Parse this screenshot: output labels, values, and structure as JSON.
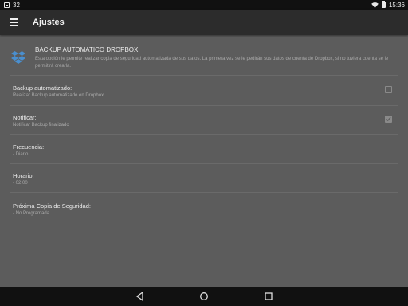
{
  "status_bar": {
    "notification_count": "32",
    "time": "15:36"
  },
  "app_bar": {
    "title": "Ajustes"
  },
  "header": {
    "title": "BACKUP AUTOMATICO DROPBOX",
    "description": "Esta opción le permite realizar copia de seguridad automatizada de sus datos. La primera vez se le pedirán sus datos de cuenta de Dropbox, si no tuviera cuenta se le permitirá crearla."
  },
  "preferences": [
    {
      "title": "Backup automatizado:",
      "summary": "Realizar Backup automatizado en Dropbox",
      "checkbox": true,
      "checked": false
    },
    {
      "title": "Notificar:",
      "summary": "Notificar Backup finalizado",
      "checkbox": true,
      "checked": true
    },
    {
      "title": "Frecuencia:",
      "summary": "- Diario",
      "checkbox": false
    },
    {
      "title": "Horario:",
      "summary": "- 02:00",
      "checkbox": false
    },
    {
      "title": "Próxima Copia de Seguridad:",
      "summary": "- No Programada",
      "checkbox": false
    }
  ],
  "icons": {
    "notification": "notification-icon",
    "wifi": "wifi-icon",
    "battery": "battery-icon",
    "menu": "menu-icon",
    "dropbox": "dropbox-icon",
    "back": "back-icon",
    "home": "home-icon",
    "recents": "recents-icon"
  },
  "colors": {
    "background": "#5c5c5c",
    "app_bar": "#2c2c2c",
    "status_bar": "#111111",
    "dropbox_blue": "#4a8fcf"
  }
}
